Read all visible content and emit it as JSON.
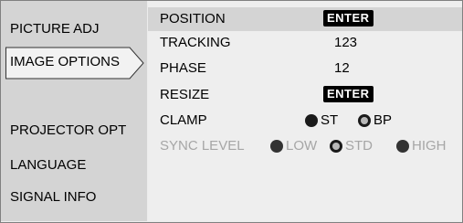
{
  "sidebar": {
    "items": [
      {
        "label": "PICTURE ADJ"
      },
      {
        "label": "IMAGE OPTIONS"
      },
      {
        "label": "PROJECTOR OPT"
      },
      {
        "label": "LANGUAGE"
      },
      {
        "label": "SIGNAL INFO"
      }
    ],
    "selected": "IMAGE OPTIONS"
  },
  "panel": {
    "rows": [
      {
        "label": "POSITION",
        "value": "ENTER"
      },
      {
        "label": "TRACKING",
        "value": "123"
      },
      {
        "label": "PHASE",
        "value": "12"
      },
      {
        "label": "RESIZE",
        "value": "ENTER"
      },
      {
        "label": "CLAMP",
        "options": [
          "ST",
          "BP"
        ],
        "selected": "BP"
      },
      {
        "label": "SYNC LEVEL",
        "options": [
          "LOW",
          "STD",
          "HIGH"
        ],
        "selected": "STD",
        "disabled": true
      }
    ]
  }
}
